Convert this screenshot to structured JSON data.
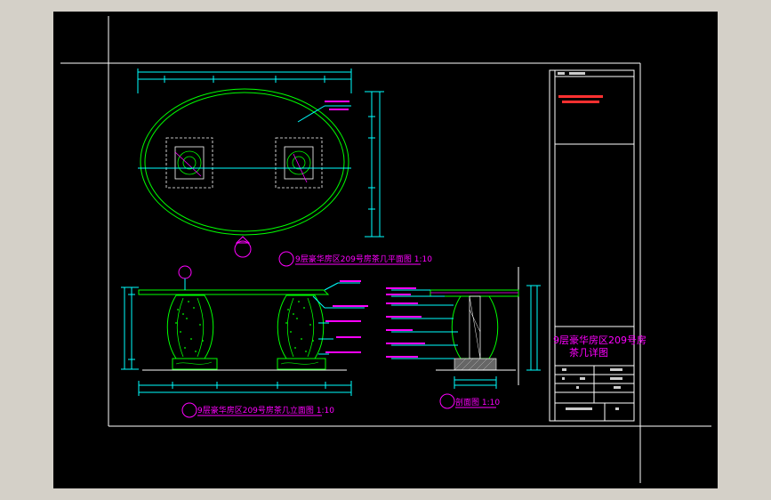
{
  "titles": {
    "plan": "9层豪华房区209号房茶几平面图 1:10",
    "elevation": "9层豪华房区209号房茶几立面图 1:10",
    "section": "剖面图 1:10"
  },
  "title_block": {
    "drawing_name_line1": "9层豪华房区209号房",
    "drawing_name_line2": "茶几详图"
  },
  "colors": {
    "background": "#000000",
    "frame": "#ffffff",
    "outline": "#00ff00",
    "dimension": "#00ffff",
    "text": "#ff00ff",
    "note": "#ff0000"
  }
}
